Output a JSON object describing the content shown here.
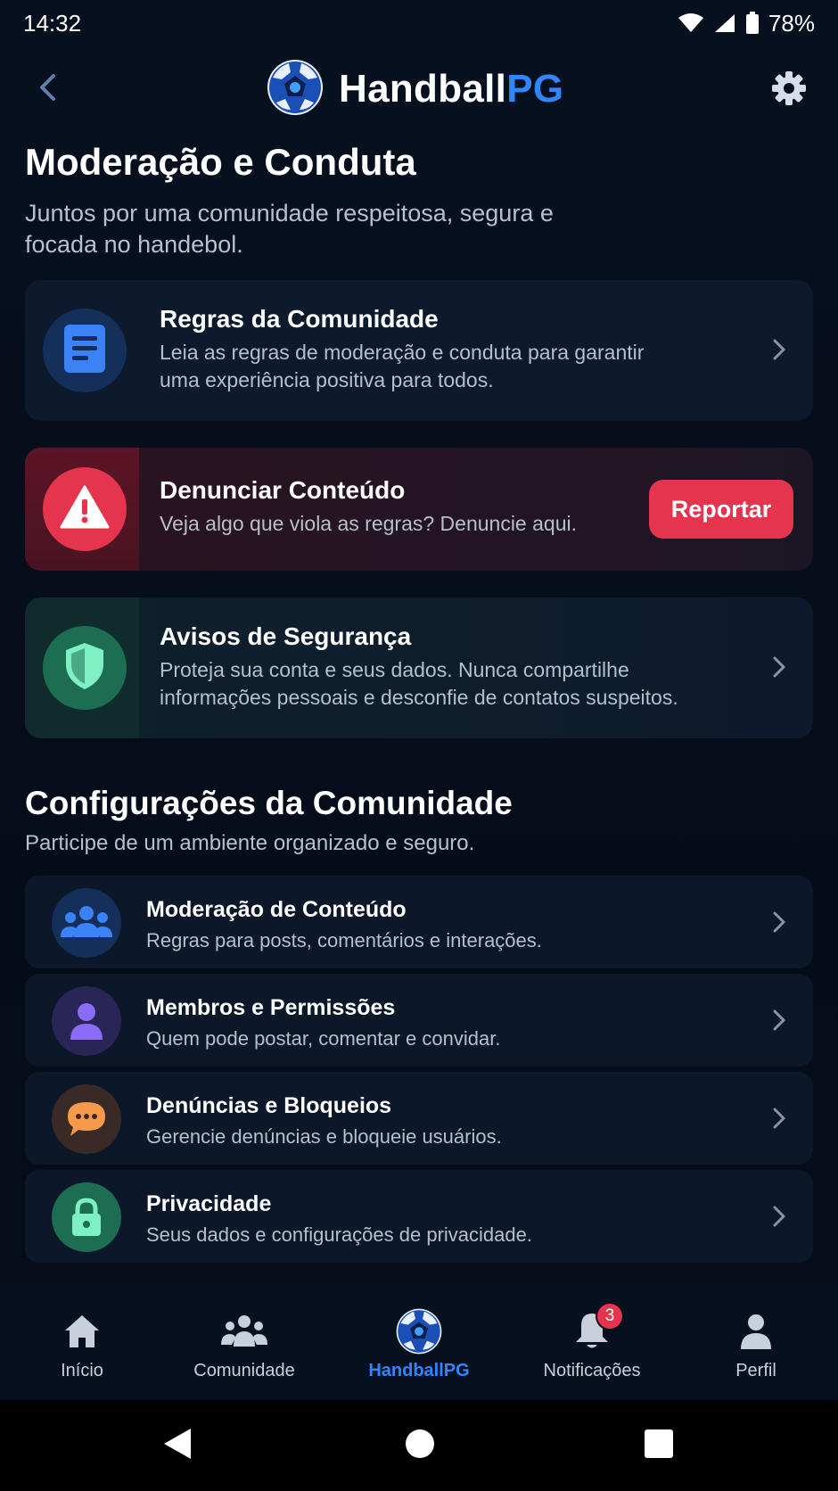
{
  "status_bar": {
    "time": "14:32",
    "battery": "78%",
    "icons": [
      "wifi-icon",
      "signal-icon",
      "battery-icon"
    ]
  },
  "header": {
    "brand_part1": "Handball",
    "brand_part2": "PG",
    "back_icon": "chevron-left-icon",
    "settings_icon": "gear-icon",
    "logo_icon": "handball-logo-icon"
  },
  "page": {
    "title": "Moderação e Conduta",
    "subtitle": "Juntos por uma comunidade respeitosa, segura e focada no handebol."
  },
  "cards": {
    "rules": {
      "title": "Regras da Comunidade",
      "desc": "Leia as regras de moderação e conduta para garantir uma experiência positiva para todos.",
      "icon": "document-icon"
    },
    "report": {
      "title": "Denunciar Conteúdo",
      "desc": "Veja algo que viola as regras? Denuncie aqui.",
      "button": "Reportar",
      "icon": "warning-icon"
    },
    "security": {
      "title": "Avisos de Segurança",
      "desc": "Proteja sua conta e seus dados. Nunca compartilhe informações pessoais e desconfie de contatos suspeitos.",
      "icon": "shield-icon"
    }
  },
  "settings_section": {
    "title": "Configurações da Comunidade",
    "subtitle": "Participe de um ambiente organizado e seguro.",
    "items": [
      {
        "title": "Moderação de Conteúdo",
        "desc": "Regras para posts, comentários e interações.",
        "icon": "users-icon"
      },
      {
        "title": "Membros e Permissões",
        "desc": "Quem pode postar, comentar e convidar.",
        "icon": "person-icon"
      },
      {
        "title": "Denúncias e Bloqueios",
        "desc": "Gerencie denúncias e bloqueie usuários.",
        "icon": "chat-bubble-icon"
      },
      {
        "title": "Privacidade",
        "desc": "Seus dados e configurações de privacidade.",
        "icon": "lock-icon"
      }
    ]
  },
  "bottom_nav": {
    "items": [
      {
        "label": "Início",
        "icon": "home-icon"
      },
      {
        "label": "Comunidade",
        "icon": "community-icon"
      },
      {
        "label": "HandballPG",
        "icon": "handball-logo-icon",
        "active": true
      },
      {
        "label": "Notificações",
        "icon": "bell-icon",
        "badge": "3"
      },
      {
        "label": "Perfil",
        "icon": "profile-icon"
      }
    ]
  },
  "colors": {
    "background": "#060d1b",
    "card": "#0d1a2d",
    "accent_blue": "#2f86ff",
    "danger_red": "#e5344e",
    "success_green": "#2fd38f",
    "text_secondary": "#b6bfcc"
  }
}
